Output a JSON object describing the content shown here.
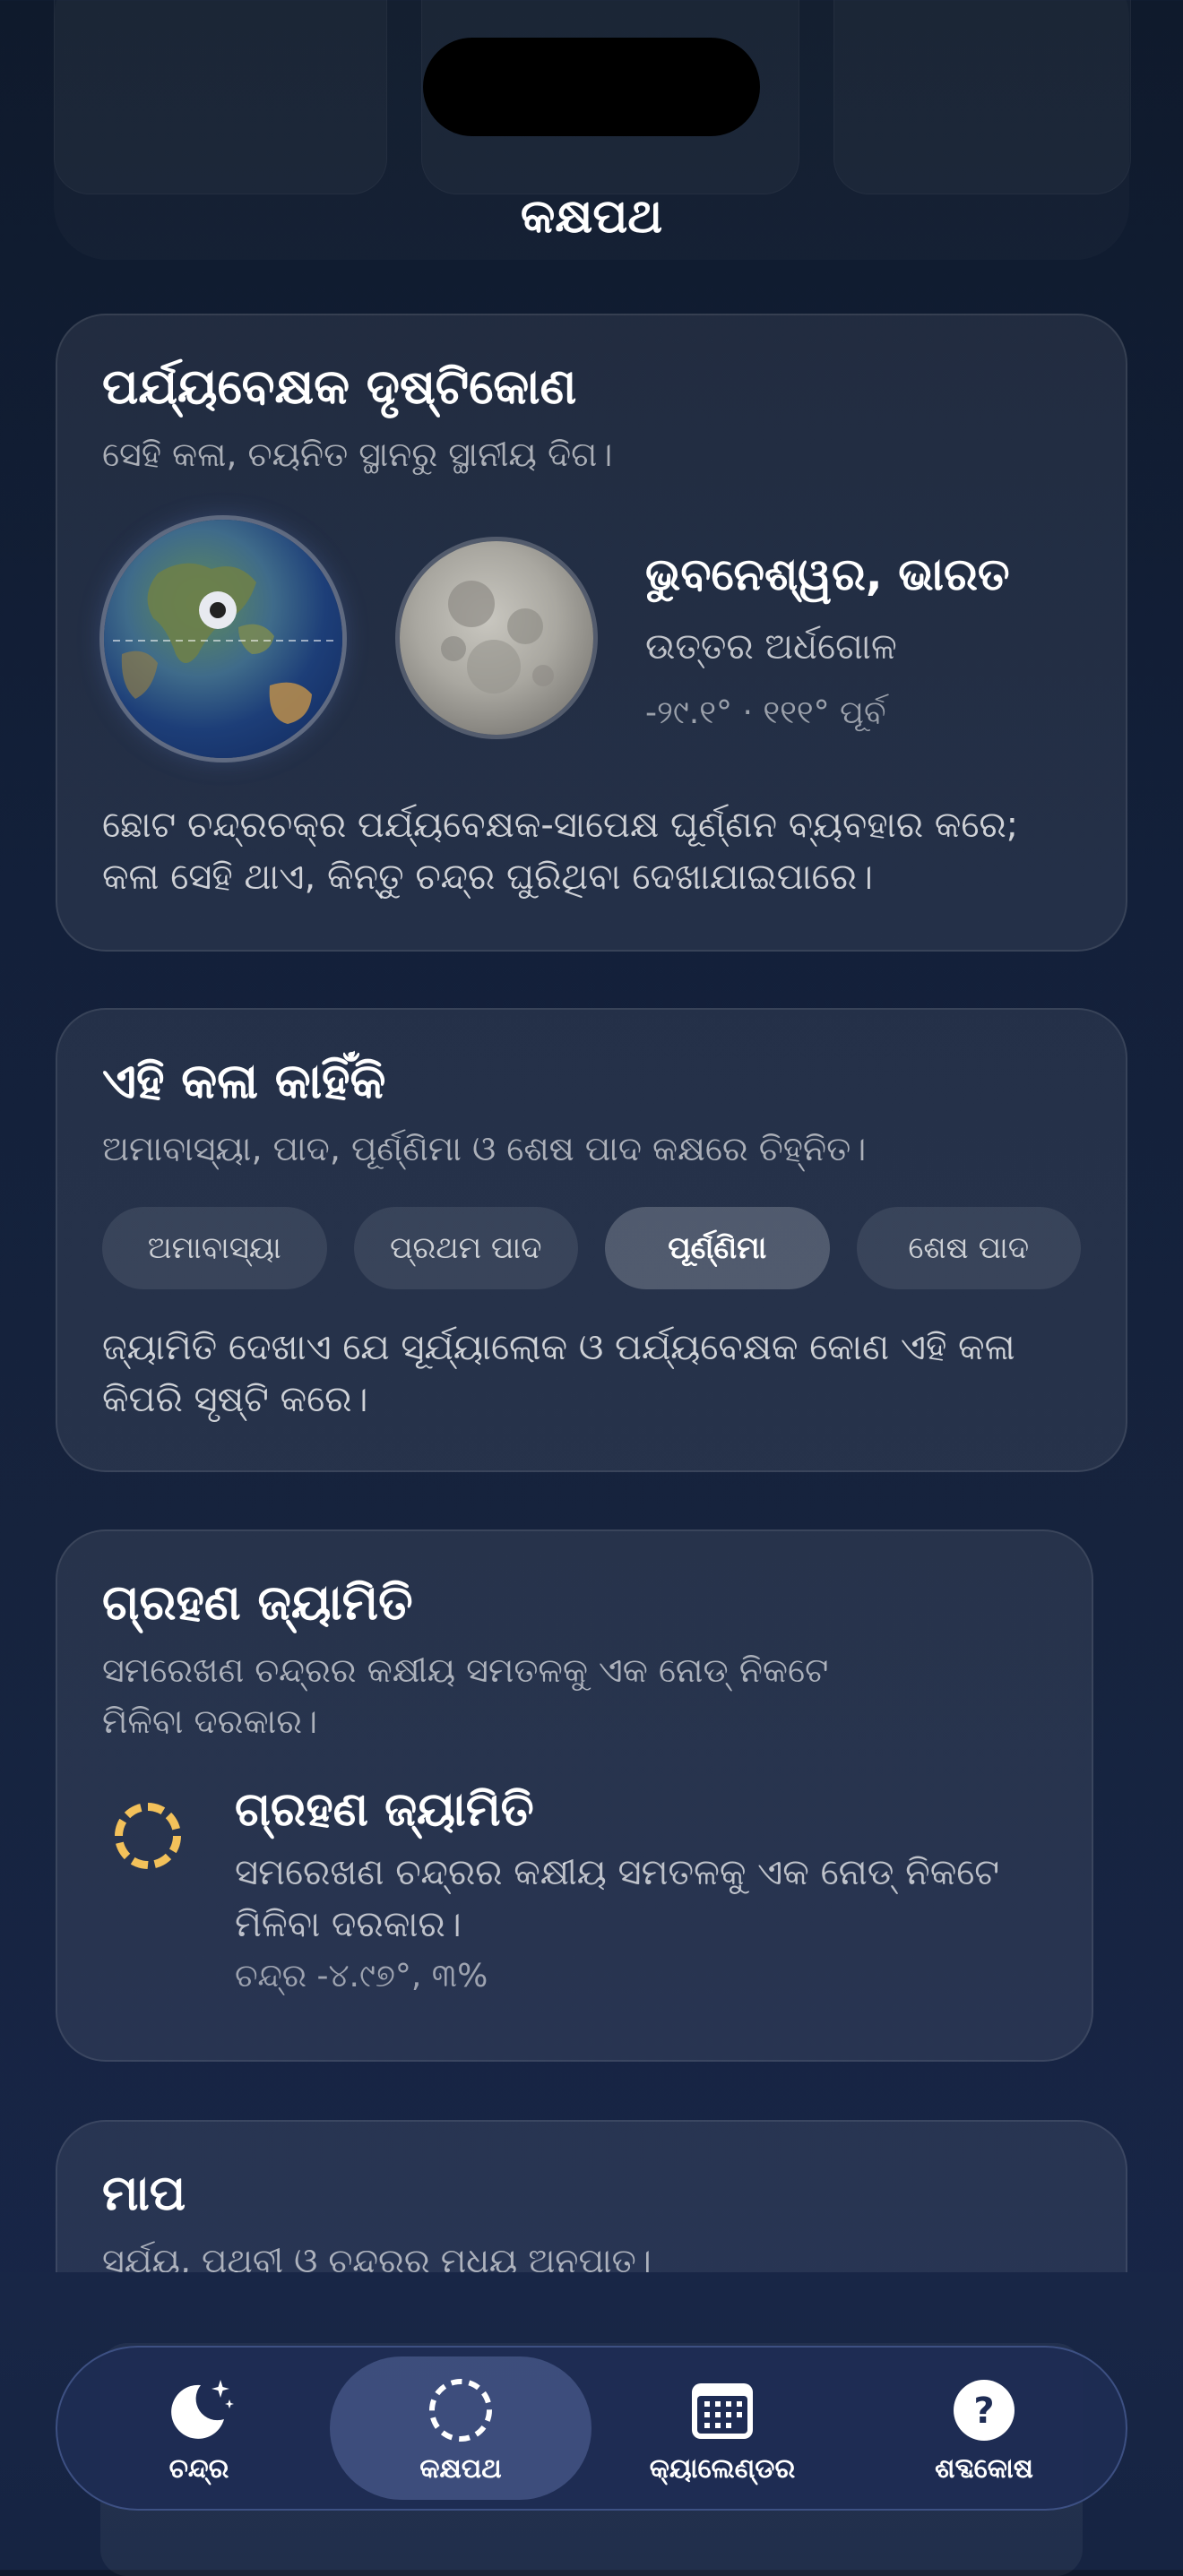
{
  "header": {
    "title": "କକ୍ଷପଥ"
  },
  "observer_card": {
    "title": "ପର୍ଯ୍ୟବେକ୍ଷକ ଦୃଷ୍ଟିକୋଣ",
    "subtitle": "ସେହି କଳା, ଚୟନିତ ସ୍ଥାନରୁ ସ୍ଥାନୀୟ ଦିଗ।",
    "location_name": "ଭୁବନେଶ୍ୱର, ଭାରତ",
    "hemisphere": "ଉତ୍ତର ଅର୍ଧଗୋଳ",
    "coordinates": "-୨୯.୧° · ୧୧୧° ପୂର୍ବ",
    "description": "ଛୋଟ ଚନ୍ଦ୍ରଚକ୍ର ପର୍ଯ୍ୟବେକ୍ଷକ-ସାପେକ୍ଷ ଘୂର୍ଣ୍ଣନ ବ୍ୟବହାର କରେ; କଳା ସେହି ଥାଏ, କିନ୍ତୁ ଚନ୍ଦ୍ର ଘୁରିଥିବା ଦେଖାଯାଇପାରେ।"
  },
  "phase_card": {
    "title": "ଏହି କଳା କାହିଁକି",
    "subtitle": "ଅମାବାସ୍ୟା, ପାଦ, ପୂର୍ଣ୍ଣିମା ଓ ଶେଷ ପାଦ କକ୍ଷରେ ଚିହ୍ନିତ।",
    "chips": [
      "ଅମାବାସ୍ୟା",
      "ପ୍ରଥମ ପାଦ",
      "ପୂର୍ଣ୍ଣିମା",
      "ଶେଷ ପାଦ"
    ],
    "selected_chip": "ପୂର୍ଣ୍ଣିମା",
    "description": "ଜ୍ୟାମିତି ଦେଖାଏ ଯେ ସୂର୍ଯ୍ୟାଲୋକ ଓ ପର୍ଯ୍ୟବେକ୍ଷକ କୋଣ ଏହି କଳା କିପରି ସୃଷ୍ଟି କରେ।"
  },
  "eclipse_card": {
    "title": "ଗ୍ରହଣ ଜ୍ୟାମିତି",
    "subtitle": "ସମରେଖଣ ଚନ୍ଦ୍ରର କକ୍ଷୀୟ ସମତଳକୁ ଏକ ନୋଡ୍ ନିକଟେ ମିଳିବା ଦରକାର।",
    "row_title": "ଗ୍ରହଣ ଜ୍ୟାମିତି",
    "row_subtitle": "ସମରେଖଣ ଚନ୍ଦ୍ରର କକ୍ଷୀୟ ସମତଳକୁ ଏକ ନୋଡ୍ ନିକଟେ ମିଳିବା ଦରକାର।",
    "row_value": "ଚନ୍ଦ୍ର -୪.୯୭°, ୩%",
    "icon": "dashed-ring-icon",
    "accent": "#f3c15a"
  },
  "measure_card": {
    "title": "ମାପ",
    "subtitle": "ସୂର୍ଯ୍ୟ, ପୃଥିବୀ ଓ ଚନ୍ଦ୍ରର ମଧ୍ୟ ଅନୁପାତ।"
  },
  "tabbar": {
    "tabs": [
      {
        "label": "ଚନ୍ଦ୍ର",
        "icon": "moon-stars-icon"
      },
      {
        "label": "କକ୍ଷପଥ",
        "icon": "orbit-icon"
      },
      {
        "label": "କ୍ୟାଲେଣ୍ଡର",
        "icon": "calendar-icon"
      },
      {
        "label": "ଶବ୍ଦକୋଷ",
        "icon": "help-icon"
      }
    ],
    "active_tab": "କକ୍ଷପଥ"
  }
}
